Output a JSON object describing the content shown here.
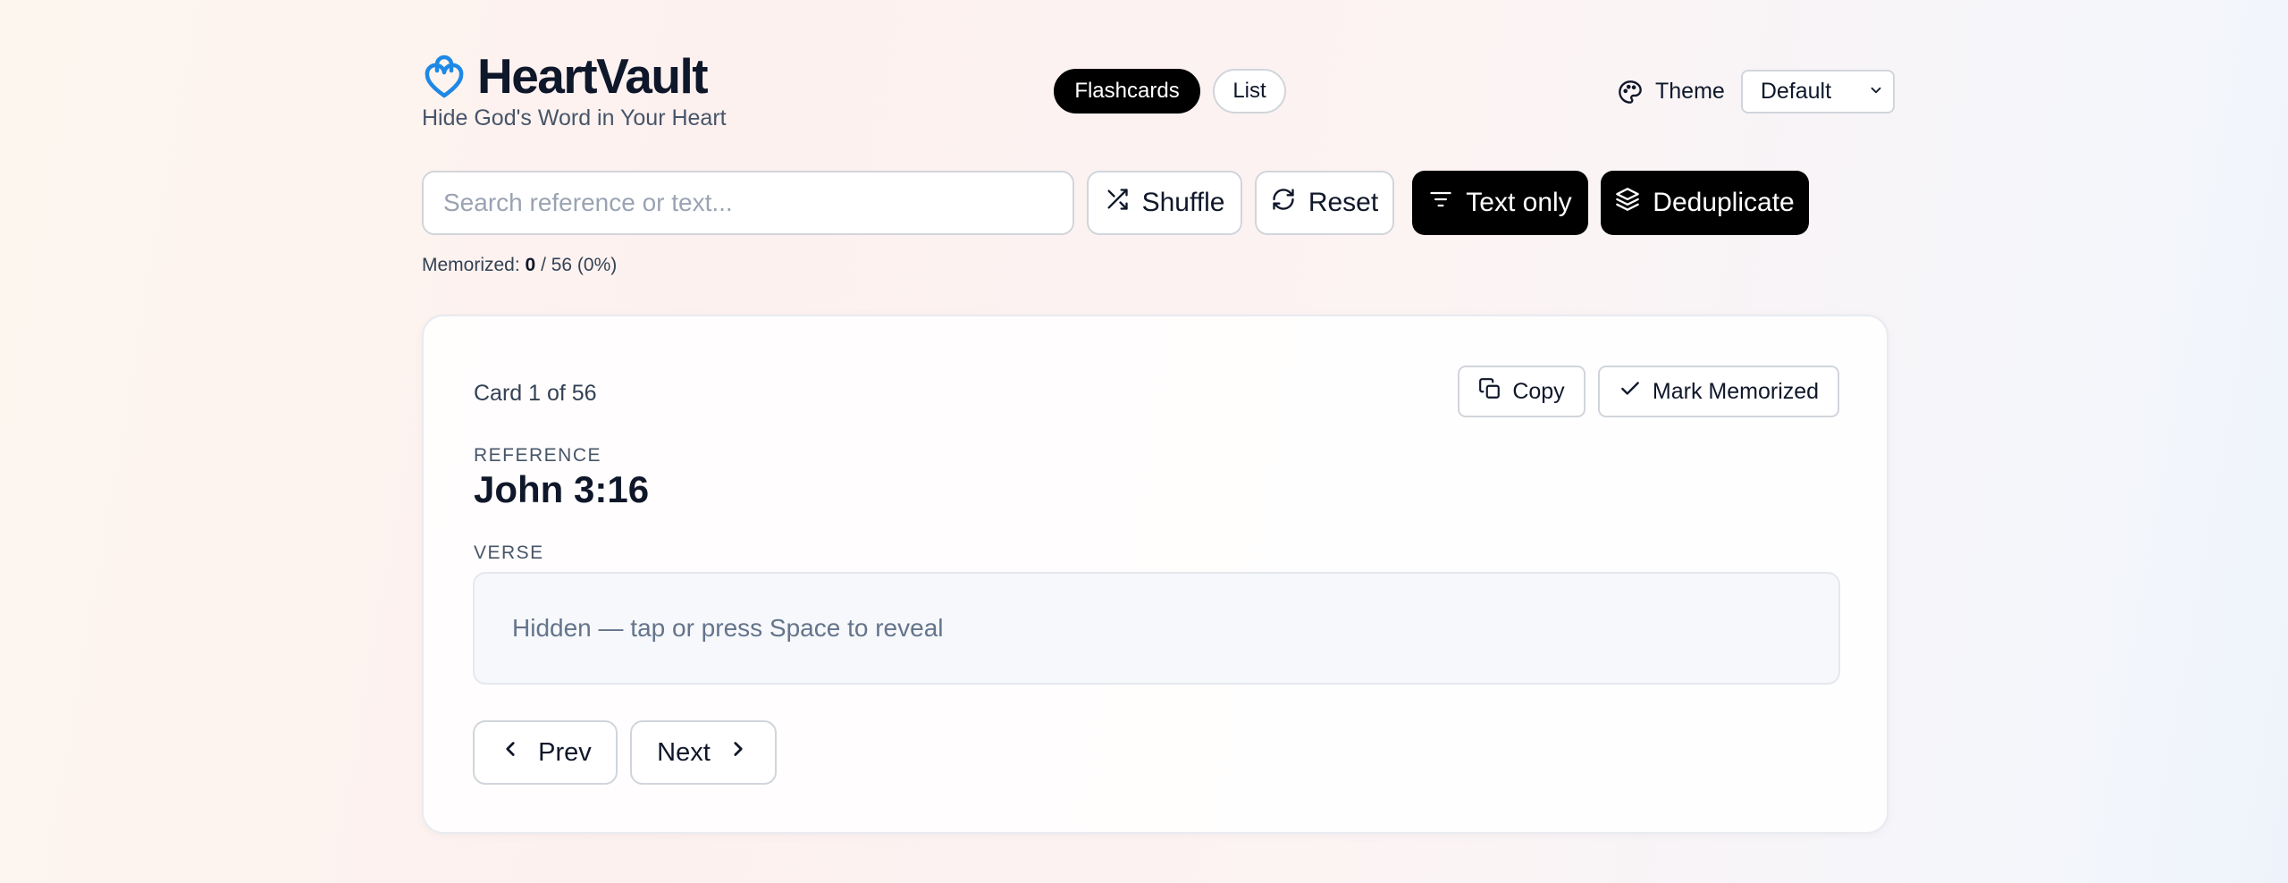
{
  "app": {
    "name": "HeartVault",
    "tagline": "Hide God's Word in Your Heart",
    "brand_color": "#1e88e5",
    "logo_icon": "heart-lock-icon"
  },
  "view_toggle": {
    "flashcards_label": "Flashcards",
    "list_label": "List",
    "active": "Flashcards"
  },
  "theme": {
    "label": "Theme",
    "icon": "palette-icon",
    "selected": "Default"
  },
  "toolbar": {
    "search_placeholder": "Search reference or text...",
    "search_value": "",
    "shuffle_label": "Shuffle",
    "reset_label": "Reset",
    "text_only_label": "Text only",
    "deduplicate_label": "Deduplicate"
  },
  "progress": {
    "label": "Memorized:",
    "memorized": "0",
    "rest": " / 56 (0%)"
  },
  "card": {
    "counter": "Card 1 of 56",
    "copy_label": "Copy",
    "mark_label": "Mark Memorized",
    "reference_label": "REFERENCE",
    "reference": "John 3:16",
    "verse_label": "VERSE",
    "verse_hidden_text": "Hidden — tap or press Space to reveal",
    "prev_label": "Prev",
    "next_label": "Next"
  }
}
